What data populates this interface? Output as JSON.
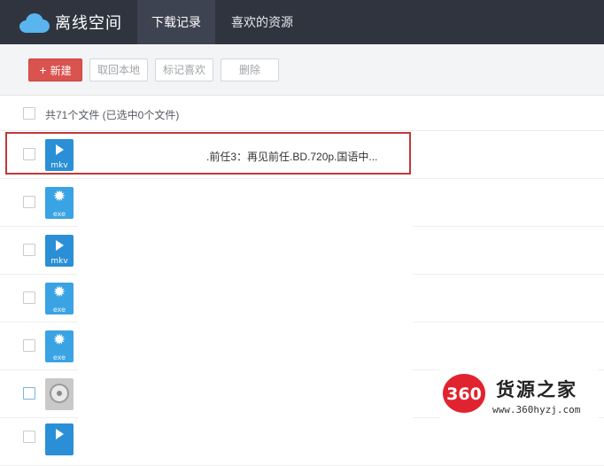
{
  "header": {
    "logo_text": "离线空间",
    "tabs": [
      {
        "label": "下载记录",
        "active": true
      },
      {
        "label": "喜欢的资源",
        "active": false
      }
    ],
    "bg_color": "#2f343f"
  },
  "toolbar": {
    "new_label": "新建",
    "retrieve_label": "取回本地",
    "mark_favorite_label": "标记喜欢",
    "delete_label": "删除",
    "accent_color": "#d9534f"
  },
  "list": {
    "summary": "共71个文件  (已选中0个文件)",
    "rows": [
      {
        "type": "mkv",
        "ext": "mkv",
        "name": ".前任3：再见前任.BD.720p.国语中...",
        "highlighted": true
      },
      {
        "type": "exe",
        "ext": "exe",
        "name": ""
      },
      {
        "type": "mkv",
        "ext": "mkv",
        "name": ""
      },
      {
        "type": "exe",
        "ext": "exe",
        "name": ""
      },
      {
        "type": "exe",
        "ext": "exe",
        "name": ""
      },
      {
        "type": "disc",
        "ext": "",
        "name": ""
      },
      {
        "type": "mkv",
        "ext": "",
        "name": ""
      }
    ]
  },
  "watermark": {
    "badge": "360",
    "title": "货源之家",
    "url": "www.360hyzj.com"
  }
}
